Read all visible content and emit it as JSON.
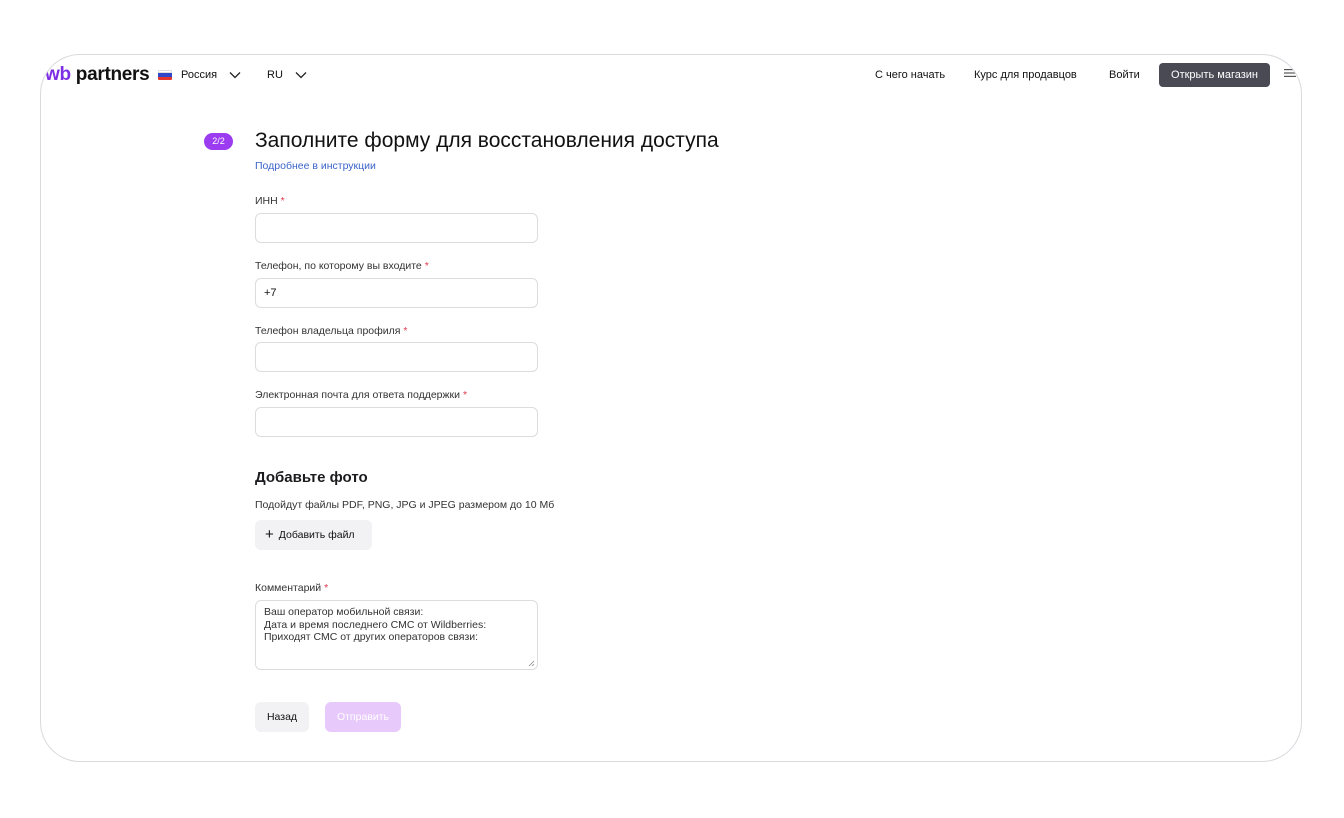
{
  "header": {
    "logo_text_wb": "wb",
    "logo_text_partners": " partners",
    "country": "Россия",
    "language": "RU",
    "nav": [
      "С чего начать",
      "Курс для продавцов",
      "Войти"
    ],
    "cta": "Открыть магазин"
  },
  "form": {
    "step": "2/2",
    "title": "Заполните форму для восстановления доступа",
    "instructions_link": "Подробнее в инструкции",
    "required_mark": "*",
    "fields": [
      {
        "label": "ИНН",
        "value": ""
      },
      {
        "label": "Телефон, по которому вы входите",
        "value": "+7"
      },
      {
        "label": "Телефон владельца профиля",
        "value": ""
      },
      {
        "label": "Электронная почта для ответа поддержки",
        "value": ""
      }
    ],
    "photo": {
      "title": "Добавьте фото",
      "hint": "Подойдут файлы PDF, PNG, JPG и JPEG размером до 10 Мб",
      "add_button": "Добавить файл"
    },
    "comment": {
      "label": "Комментарий",
      "value": "Ваш оператор мобильной связи:\nДата и время последнего СМС от Wildberries:\nПриходят СМС от других операторов связи:"
    },
    "back_button": "Назад",
    "submit_button": "Отправить"
  }
}
